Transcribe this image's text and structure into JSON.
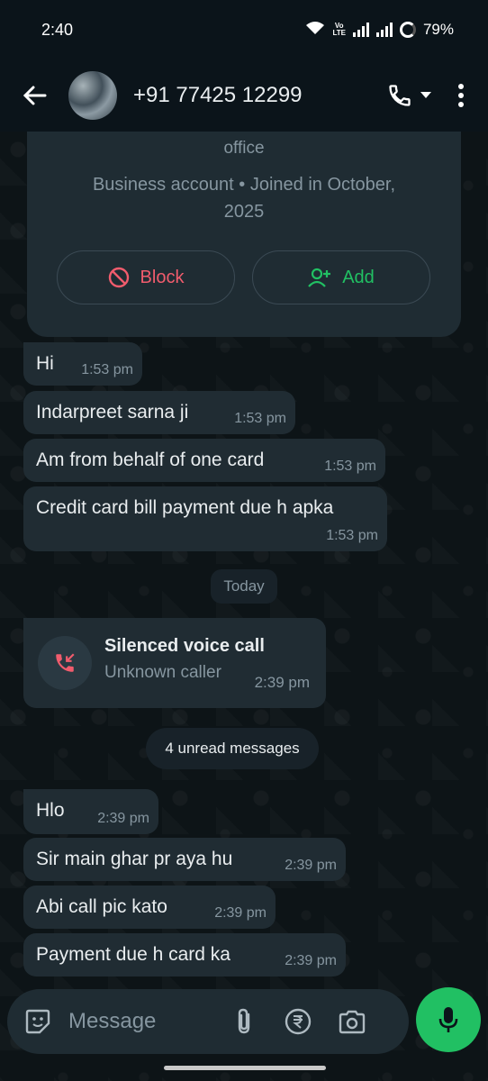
{
  "status_bar": {
    "time": "2:40",
    "volte": "Vo LTE",
    "battery": "79%"
  },
  "header": {
    "contact": "+91 77425 12299",
    "avatar_icon": "avatar-photo",
    "call_icon": "phone-icon",
    "menu_icon": "more-vert-icon"
  },
  "business_card": {
    "office_text": "office",
    "info_line1": "Business account • Joined in October,",
    "info_line2": "2025",
    "block_label": "Block",
    "add_label": "Add"
  },
  "messages_before": [
    {
      "text": "Hi",
      "time": "1:53 pm"
    },
    {
      "text": "Indarpreet sarna ji",
      "time": "1:53 pm"
    },
    {
      "text": "Am from behalf of one card",
      "time": "1:53 pm"
    },
    {
      "text": "Credit card bill payment due h apka",
      "time": "1:53 pm"
    }
  ],
  "date_divider": "Today",
  "call": {
    "title": "Silenced voice call",
    "subtitle": "Unknown caller",
    "time": "2:39 pm"
  },
  "unread_label": "4 unread messages",
  "messages_after": [
    {
      "text": "Hlo",
      "time": "2:39 pm"
    },
    {
      "text": "Sir main ghar pr aya hu",
      "time": "2:39 pm"
    },
    {
      "text": "Abi call pic kato",
      "time": "2:39 pm"
    },
    {
      "text": "Payment due h card ka",
      "time": "2:39 pm"
    }
  ],
  "composer": {
    "placeholder": "Message"
  },
  "colors": {
    "accent": "#21c063",
    "danger": "#f15c6d",
    "bubble": "#202c33",
    "background": "#0b141a"
  }
}
